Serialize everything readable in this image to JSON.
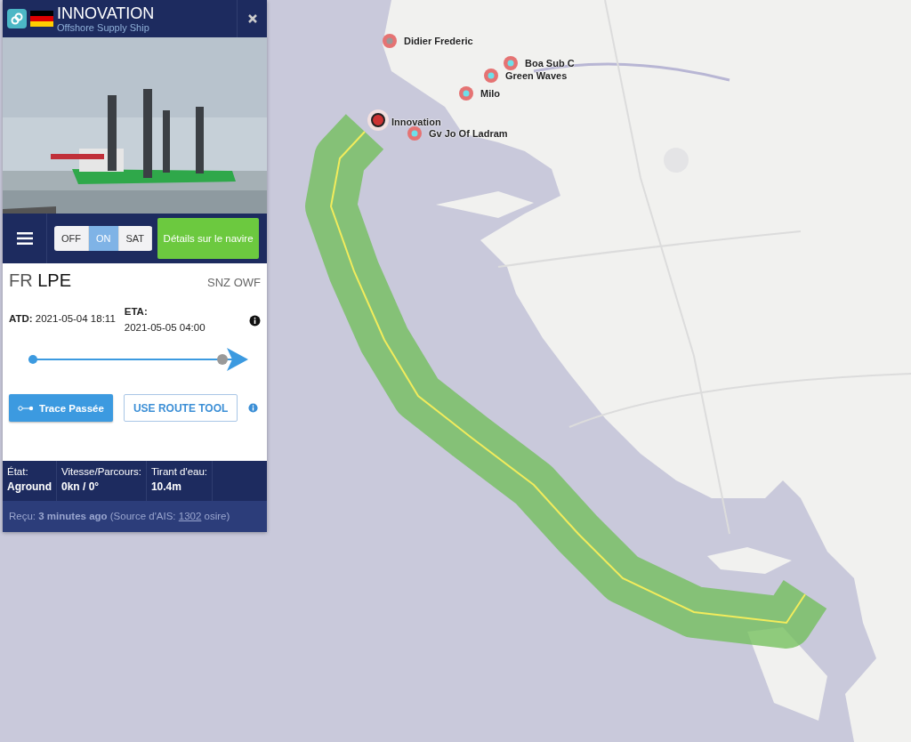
{
  "vessel": {
    "name": "INNOVATION",
    "type": "Offshore Supply Ship"
  },
  "layer_toggle": [
    {
      "label": "OFF",
      "selected": false
    },
    {
      "label": "ON",
      "selected": true
    },
    {
      "label": "SAT",
      "selected": false
    }
  ],
  "details_button": "Détails sur le navire",
  "route": {
    "origin_country": "FR",
    "origin_port": "LPE",
    "destination": "SNZ OWF"
  },
  "atd": {
    "label": "ATD:",
    "value": "2021-05-04 18:11"
  },
  "eta": {
    "label": "ETA:",
    "value": "2021-05-05 04:00"
  },
  "progress": {
    "level": 0.95
  },
  "trace_button": "Trace Passée",
  "route_tool_button": "USE ROUTE TOOL",
  "stats": [
    {
      "label": "État:",
      "value": "Aground"
    },
    {
      "label": "Vitesse/Parcours:",
      "value": "0kn / 0°"
    },
    {
      "label": "Tirant d'eau:",
      "value": "10.4m"
    }
  ],
  "received": {
    "text": "Reçu: **3 minutes ago** (Source d'AIS: ",
    "link": "1302",
    "suffix": " osire)"
  },
  "map_vessels": [
    {
      "label": "Didier Frederic"
    },
    {
      "label": "Boa Sub C"
    },
    {
      "label": "Green Waves"
    },
    {
      "label": "Milo"
    },
    {
      "label": "Innovation"
    },
    {
      "label": "Gv Jo Of Ladram"
    }
  ]
}
